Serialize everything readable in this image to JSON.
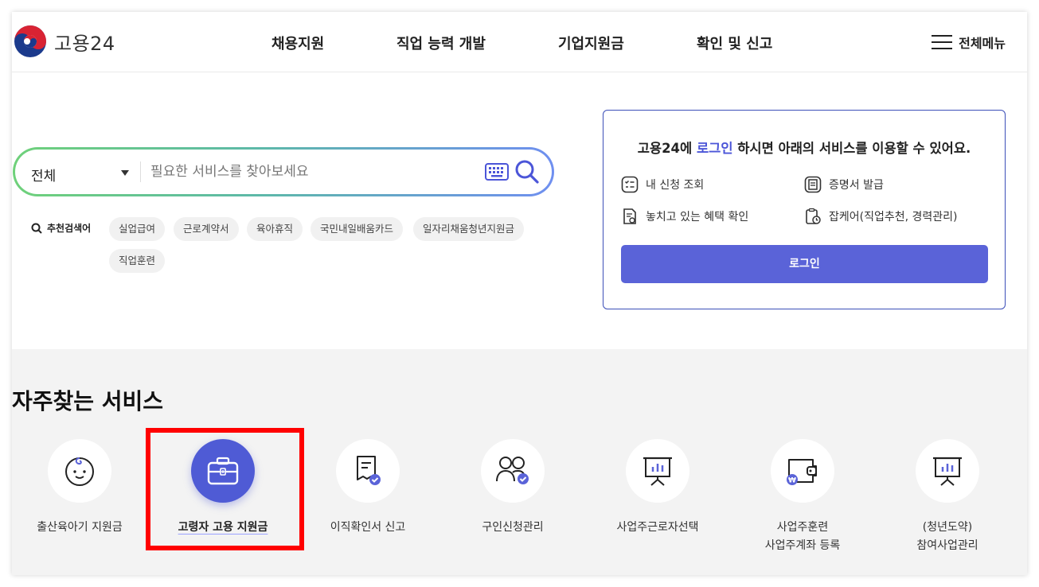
{
  "header": {
    "logo_text": "고용24",
    "nav": [
      "채용지원",
      "직업 능력 개발",
      "기업지원금",
      "확인 및 신고"
    ],
    "all_menu_label": "전체메뉴"
  },
  "search": {
    "category": "전체",
    "placeholder": "필요한 서비스를 찾아보세요",
    "recommended_label": "추천검색어",
    "chips": [
      "실업급여",
      "근로계약서",
      "육아휴직",
      "국민내일배움카드",
      "일자리채움청년지원금",
      "직업훈련"
    ]
  },
  "login_card": {
    "msg_prefix": "고용24에 ",
    "msg_link": "로그인",
    "msg_suffix": " 하시면 아래의 서비스를 이용할 수 있어요.",
    "services": [
      "내 신청 조회",
      "증명서 발급",
      "놓치고 있는 혜택 확인",
      "잡케어(직업추천, 경력관리)"
    ],
    "login_button": "로그인"
  },
  "frequent": {
    "title": "자주찾는 서비스",
    "items": [
      {
        "label": "출산육아기 지원금",
        "icon": "baby-icon"
      },
      {
        "label": "고령자 고용 지원금",
        "icon": "briefcase-icon"
      },
      {
        "label": "이직확인서 신고",
        "icon": "document-check-icon"
      },
      {
        "label": "구인신청관리",
        "icon": "people-check-icon"
      },
      {
        "label": "사업주근로자선택",
        "icon": "chart-board-icon"
      },
      {
        "label": "사업주훈련",
        "label2": "사업주계좌 등록",
        "icon": "wallet-won-icon"
      },
      {
        "label": "(청년도약)",
        "label2": "참여사업관리",
        "icon": "chart-board-icon"
      }
    ]
  },
  "colors": {
    "accent": "#5a63d8",
    "highlight": "#ff0000",
    "card_border": "#3c4fb8"
  }
}
